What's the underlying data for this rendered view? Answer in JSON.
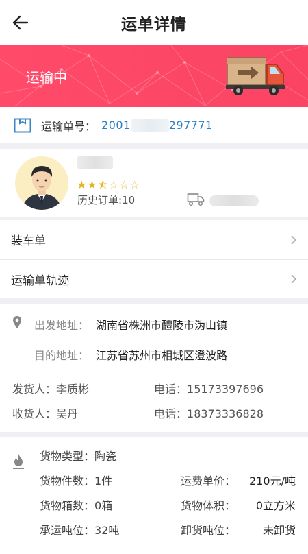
{
  "header": {
    "title": "运单详情",
    "back_icon": "arrow-left-icon"
  },
  "banner": {
    "status": "运输中",
    "brand_color": "#fb4464"
  },
  "waybill": {
    "label": "运输单号：",
    "number_prefix": "2001",
    "number_suffix": "297771"
  },
  "driver": {
    "rating": {
      "filled": 2.5,
      "max": 5
    },
    "stars_filled": "★★",
    "stars_half": "⯪",
    "stars_empty": "☆☆☆",
    "history_label": "历史订单:",
    "history_count": "10"
  },
  "menu": {
    "items": [
      {
        "label": "装车单"
      },
      {
        "label": "运输单轨迹"
      }
    ]
  },
  "address": {
    "from_label": "出发地址：",
    "from_value": "湖南省株洲市醴陵市沩山镇",
    "to_label": "目的地址：",
    "to_value": "江苏省苏州市相城区澄波路"
  },
  "contacts": {
    "sender_label": "发货人：",
    "sender_name": "李质彬",
    "sender_phone_label": "电话：",
    "sender_phone": "15173397696",
    "receiver_label": "收货人：",
    "receiver_name": "吴丹",
    "receiver_phone_label": "电话：",
    "receiver_phone": "18373336828"
  },
  "goods": {
    "type_label": "货物类型：",
    "type_value": "陶瓷",
    "pieces_label": "货物件数：",
    "pieces_value": "1件",
    "unit_price_label": "运费单价：",
    "unit_price_value": "210元/吨",
    "boxes_label": "货物箱数：",
    "boxes_value": "0箱",
    "volume_label": "货物体积：",
    "volume_value": "0立方米",
    "tonnage_label": "承运吨位：",
    "tonnage_value": "32吨",
    "unload_label": "卸货吨位：",
    "unload_value": "未卸货"
  }
}
